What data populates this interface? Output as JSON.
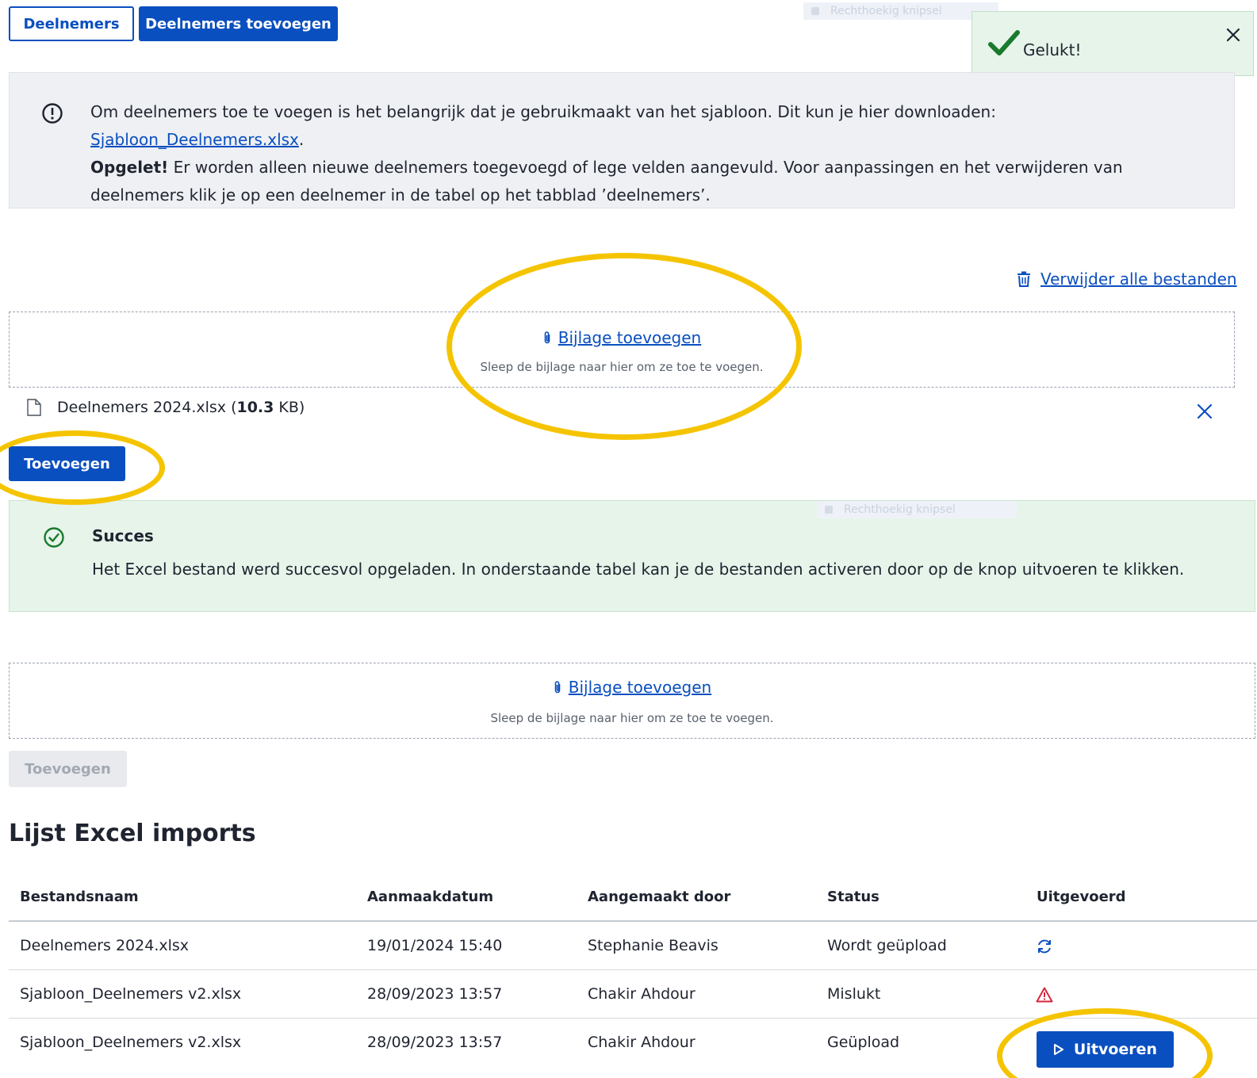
{
  "tabs": [
    {
      "label": "Deelnemers"
    },
    {
      "label": "Deelnemers toevoegen"
    }
  ],
  "snip_label": "Rechthoekig knipsel",
  "toast": {
    "title": "Gelukt!"
  },
  "info": {
    "text_1": "Om deelnemers toe te voegen is het belangrijk dat je gebruikmaakt van het sjabloon. Dit kun je hier downloaden: ",
    "template_link": "Sjabloon_Deelnemers.xlsx",
    "text_2": ".",
    "warning_bold": "Opgelet!",
    "text_3": " Er worden alleen nieuwe deelnemers toegevoegd of lege velden aangevuld. Voor aanpassingen en het verwijderen van deelnemers klik je op een deelnemer in de tabel op het tabblad ’deelnemers’."
  },
  "delete_all_label": "Verwijder alle bestanden",
  "dropzone": {
    "link_label": "Bijlage toevoegen",
    "hint": "Sleep de bijlage naar hier om ze toe te voegen."
  },
  "file": {
    "name": "Deelnemers 2024.xlsx",
    "size_value": "10.3",
    "size_unit": "KB"
  },
  "add_button_label": "Toevoegen",
  "success": {
    "title": "Succes",
    "text": "Het Excel bestand werd succesvol opgeladen. In onderstaande tabel kan je de bestanden activeren door op de knop uitvoeren te klikken."
  },
  "list_title": "Lijst Excel imports",
  "table": {
    "headers": [
      "Bestandsnaam",
      "Aanmaakdatum",
      "Aangemaakt door",
      "Status",
      "Uitgevoerd"
    ],
    "rows": [
      {
        "file": "Deelnemers 2024.xlsx",
        "date": "19/01/2024 15:40",
        "by": "Stephanie Beavis",
        "status": "Wordt geüpload",
        "executed": "sync-icon"
      },
      {
        "file": "Sjabloon_Deelnemers v2.xlsx",
        "date": "28/09/2023 13:57",
        "by": "Chakir Ahdour",
        "status": "Mislukt",
        "executed": "warning-icon"
      },
      {
        "file": "Sjabloon_Deelnemers v2.xlsx",
        "date": "28/09/2023 13:57",
        "by": "Chakir Ahdour",
        "status": "Geüpload",
        "executed": "Uitvoeren"
      }
    ]
  },
  "colors": {
    "primary": "#0a4fbf",
    "success_bg": "#e6f4ea",
    "info_bg": "#eef0f4",
    "annotation": "#f5c400",
    "error": "#d7263d"
  }
}
